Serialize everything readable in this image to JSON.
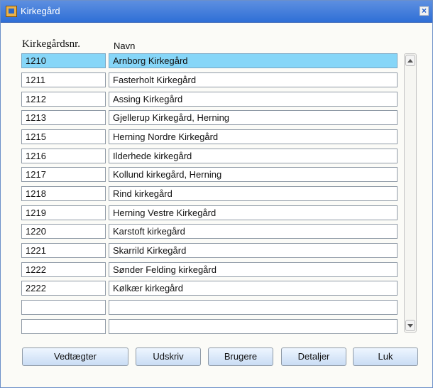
{
  "window": {
    "title": "Kirkegård"
  },
  "columns": {
    "nr": "Kirkegårdsnr.",
    "navn": "Navn"
  },
  "rows": [
    {
      "nr": "1210",
      "navn": "Arnborg Kirkegård",
      "selected": true
    },
    {
      "nr": "1211",
      "navn": "Fasterholt Kirkegård"
    },
    {
      "nr": "1212",
      "navn": "Assing Kirkegård"
    },
    {
      "nr": "1213",
      "navn": "Gjellerup Kirkegård, Herning"
    },
    {
      "nr": "1215",
      "navn": "Herning Nordre Kirkegård"
    },
    {
      "nr": "1216",
      "navn": "Ilderhede kirkegård"
    },
    {
      "nr": "1217",
      "navn": "Kollund kirkegård, Herning"
    },
    {
      "nr": "1218",
      "navn": "Rind kirkegård"
    },
    {
      "nr": "1219",
      "navn": "Herning Vestre Kirkegård"
    },
    {
      "nr": "1220",
      "navn": "Karstoft kirkegård"
    },
    {
      "nr": "1221",
      "navn": "Skarrild Kirkegård"
    },
    {
      "nr": "1222",
      "navn": "Sønder Felding kirkegård"
    },
    {
      "nr": "2222",
      "navn": "Kølkær kirkegård"
    },
    {
      "nr": "",
      "navn": ""
    },
    {
      "nr": "",
      "navn": ""
    }
  ],
  "buttons": {
    "vedtaegter": "Vedtægter",
    "udskriv": "Udskriv",
    "brugere": "Brugere",
    "detaljer": "Detaljer",
    "luk": "Luk"
  },
  "colors": {
    "titlebar": "#2f6fd6",
    "selected_row": "#86d6f8"
  }
}
